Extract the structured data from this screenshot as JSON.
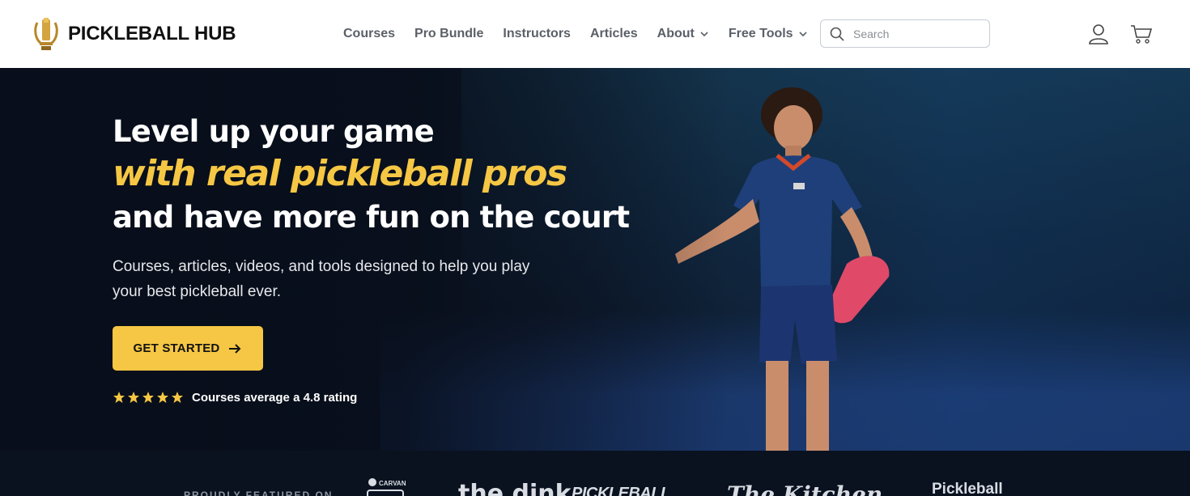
{
  "header": {
    "logo_text": "PICKLEBALL HUB",
    "nav": [
      {
        "label": "Courses"
      },
      {
        "label": "Pro Bundle"
      },
      {
        "label": "Instructors"
      },
      {
        "label": "Articles"
      },
      {
        "label": "About",
        "has_dropdown": true
      },
      {
        "label": "Free Tools",
        "has_dropdown": true
      }
    ],
    "search": {
      "placeholder": "Search",
      "value": "",
      "icon": "search-icon"
    },
    "icons": {
      "account": "user-icon",
      "cart": "cart-icon"
    }
  },
  "hero": {
    "line1": "Level up your game",
    "line2": "with real pickleball pros",
    "line3": "and have more fun on the court",
    "subtitle": "Courses, articles, videos, and tools designed to help you play your best pickleball ever.",
    "cta_label": "GET STARTED",
    "rating_stars": 5,
    "rating_prefix": "Courses average a",
    "rating_value": "4.8",
    "rating_suffix": "rating"
  },
  "featured": {
    "label": "PROUDLY FEATURED ON",
    "brands": [
      "CARVANA",
      "the dink",
      "PICKLEBALL",
      "The Kitchen",
      "Pickleball"
    ]
  },
  "colors": {
    "accent": "#f6c744",
    "nav_text": "#5b6068",
    "hero_bg": "#0c1424"
  }
}
